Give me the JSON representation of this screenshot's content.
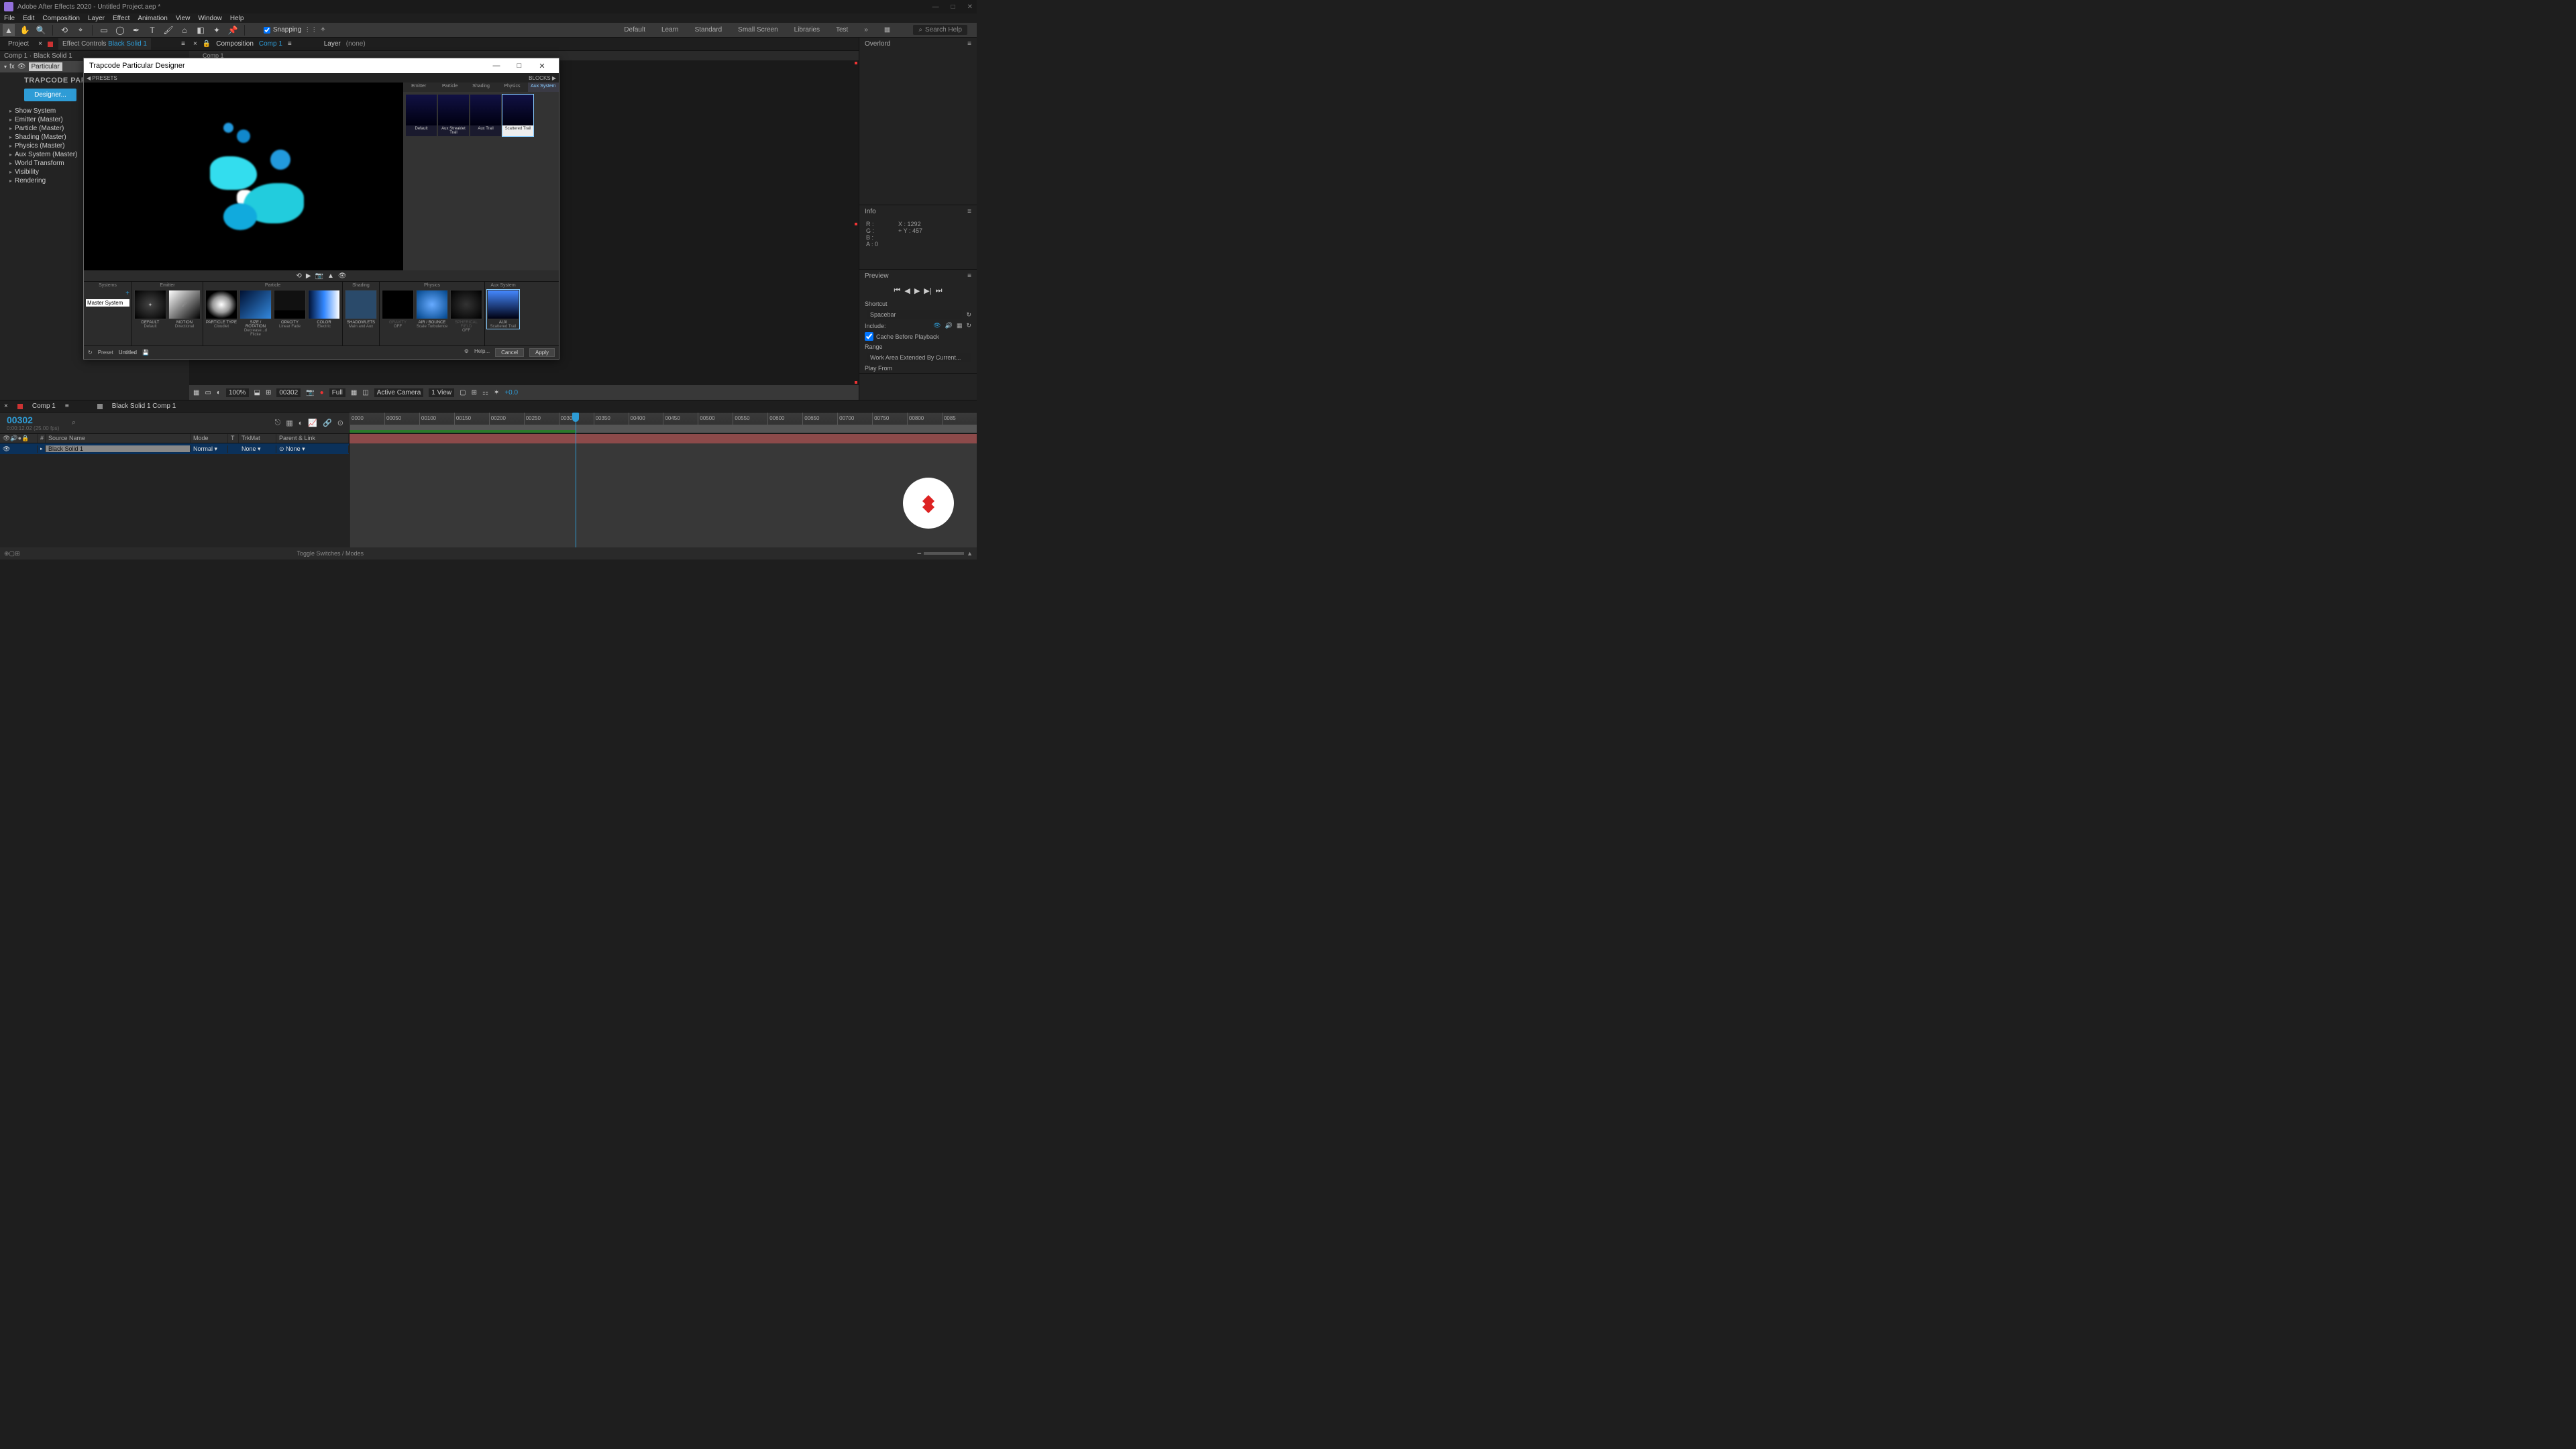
{
  "title": "Adobe After Effects 2020 - Untitled Project.aep *",
  "menu": [
    "File",
    "Edit",
    "Composition",
    "Layer",
    "Effect",
    "Animation",
    "View",
    "Window",
    "Help"
  ],
  "toolbar": {
    "snapping": "Snapping"
  },
  "workspaces": [
    "Default",
    "Learn",
    "Standard",
    "Small Screen",
    "Libraries",
    "Test"
  ],
  "search_placeholder": "Search Help",
  "left": {
    "tabs": {
      "project": "Project",
      "effect_controls": "Effect Controls",
      "layer_link": "Black Solid 1"
    },
    "header": "Comp 1 · Black Solid 1",
    "fx_name": "Particular",
    "logo": "TRAPCODE PARTICUL",
    "designer": "Designer...",
    "props": [
      "Show System",
      "Emitter (Master)",
      "Particle (Master)",
      "Shading (Master)",
      "Physics (Master)",
      "Aux System (Master)",
      "World Transform",
      "Visibility",
      "Rendering"
    ]
  },
  "comp": {
    "tabs": {
      "composition": "Composition",
      "link": "Comp 1",
      "layer": "Layer",
      "none": "(none)"
    },
    "sub": "Comp 1",
    "footer": {
      "zoom": "100%",
      "time": "00302",
      "res": "Full",
      "camera": "Active Camera",
      "view": "1 View",
      "exp": "+0.0"
    }
  },
  "right": {
    "overlord": "Overlord",
    "info": {
      "title": "Info",
      "r": "R :",
      "g": "G :",
      "b": "B :",
      "a": "A :",
      "aval": "0",
      "x": "X : 1292",
      "y": "Y : 457"
    },
    "preview": {
      "title": "Preview",
      "shortcut_lbl": "Shortcut",
      "shortcut": "Spacebar",
      "include_lbl": "Include:",
      "cache": "Cache Before Playback",
      "range_lbl": "Range",
      "range": "Work Area Extended By Current...",
      "playfrom": "Play From"
    }
  },
  "dialog": {
    "title": "Trapcode Particular Designer",
    "presets": "PRESETS",
    "blocks": "BLOCKS",
    "block_tabs": [
      "Emitter",
      "Particle",
      "Shading",
      "Physics",
      "Aux System"
    ],
    "block_thumbs": [
      "Default",
      "Aux Streaklet Trail",
      "Aux Trail",
      "Scattered Trail"
    ],
    "preset_row": {
      "preset": "Preset",
      "untitled": "Untitled",
      "help": "Help...",
      "cancel": "Cancel",
      "apply": "Apply"
    },
    "strip": {
      "systems": "Systems",
      "master": "Master System",
      "emitter": "Emitter",
      "particle": "Particle",
      "shading": "Shading",
      "physics": "Physics",
      "aux": "Aux System",
      "thumbs": {
        "default_t": "DEFAULT",
        "default_s": "Default",
        "motion_t": "MOTION",
        "motion_s": "Directional",
        "ptype_t": "PARTICLE TYPE",
        "ptype_s": "Cloudlet",
        "size_t": "SIZE / ROTATION",
        "size_s": "Decrease...d Flicke",
        "opac_t": "OPACITY",
        "opac_s": "Linear Fade",
        "color_t": "COLOR",
        "color_s": "Electric",
        "shadow_t": "SHADOWLETS",
        "shadow_s": "Main and Aux",
        "grav_t": "GRAVITY",
        "grav_s": "OFF",
        "air_t": "AIR / BOUNCE",
        "air_s": "Scale Turbulence",
        "sph_t": "SPHERICAL FIELD",
        "sph_s": "OFF",
        "aux_t": "AUX",
        "aux_s": "Scattered Trail"
      }
    }
  },
  "timeline": {
    "tabs": {
      "comp": "Comp 1",
      "queue": "Black Solid 1 Comp 1"
    },
    "time": "00302",
    "time_sub": "0:00:12.02 (25.00 fps)",
    "cols": [
      "",
      "#",
      "Source Name",
      "Mode",
      "T",
      "TrkMat",
      "Parent & Link"
    ],
    "layer": {
      "num": "1",
      "name": "Black Solid 1",
      "mode": "Normal",
      "trk": "None"
    },
    "ticks": [
      "0000",
      "00050",
      "00100",
      "00150",
      "00200",
      "00250",
      "00300",
      "00350",
      "00400",
      "00450",
      "00500",
      "00550",
      "00600",
      "00650",
      "00700",
      "00750",
      "00800",
      "0085"
    ],
    "toggle": "Toggle Switches / Modes"
  }
}
